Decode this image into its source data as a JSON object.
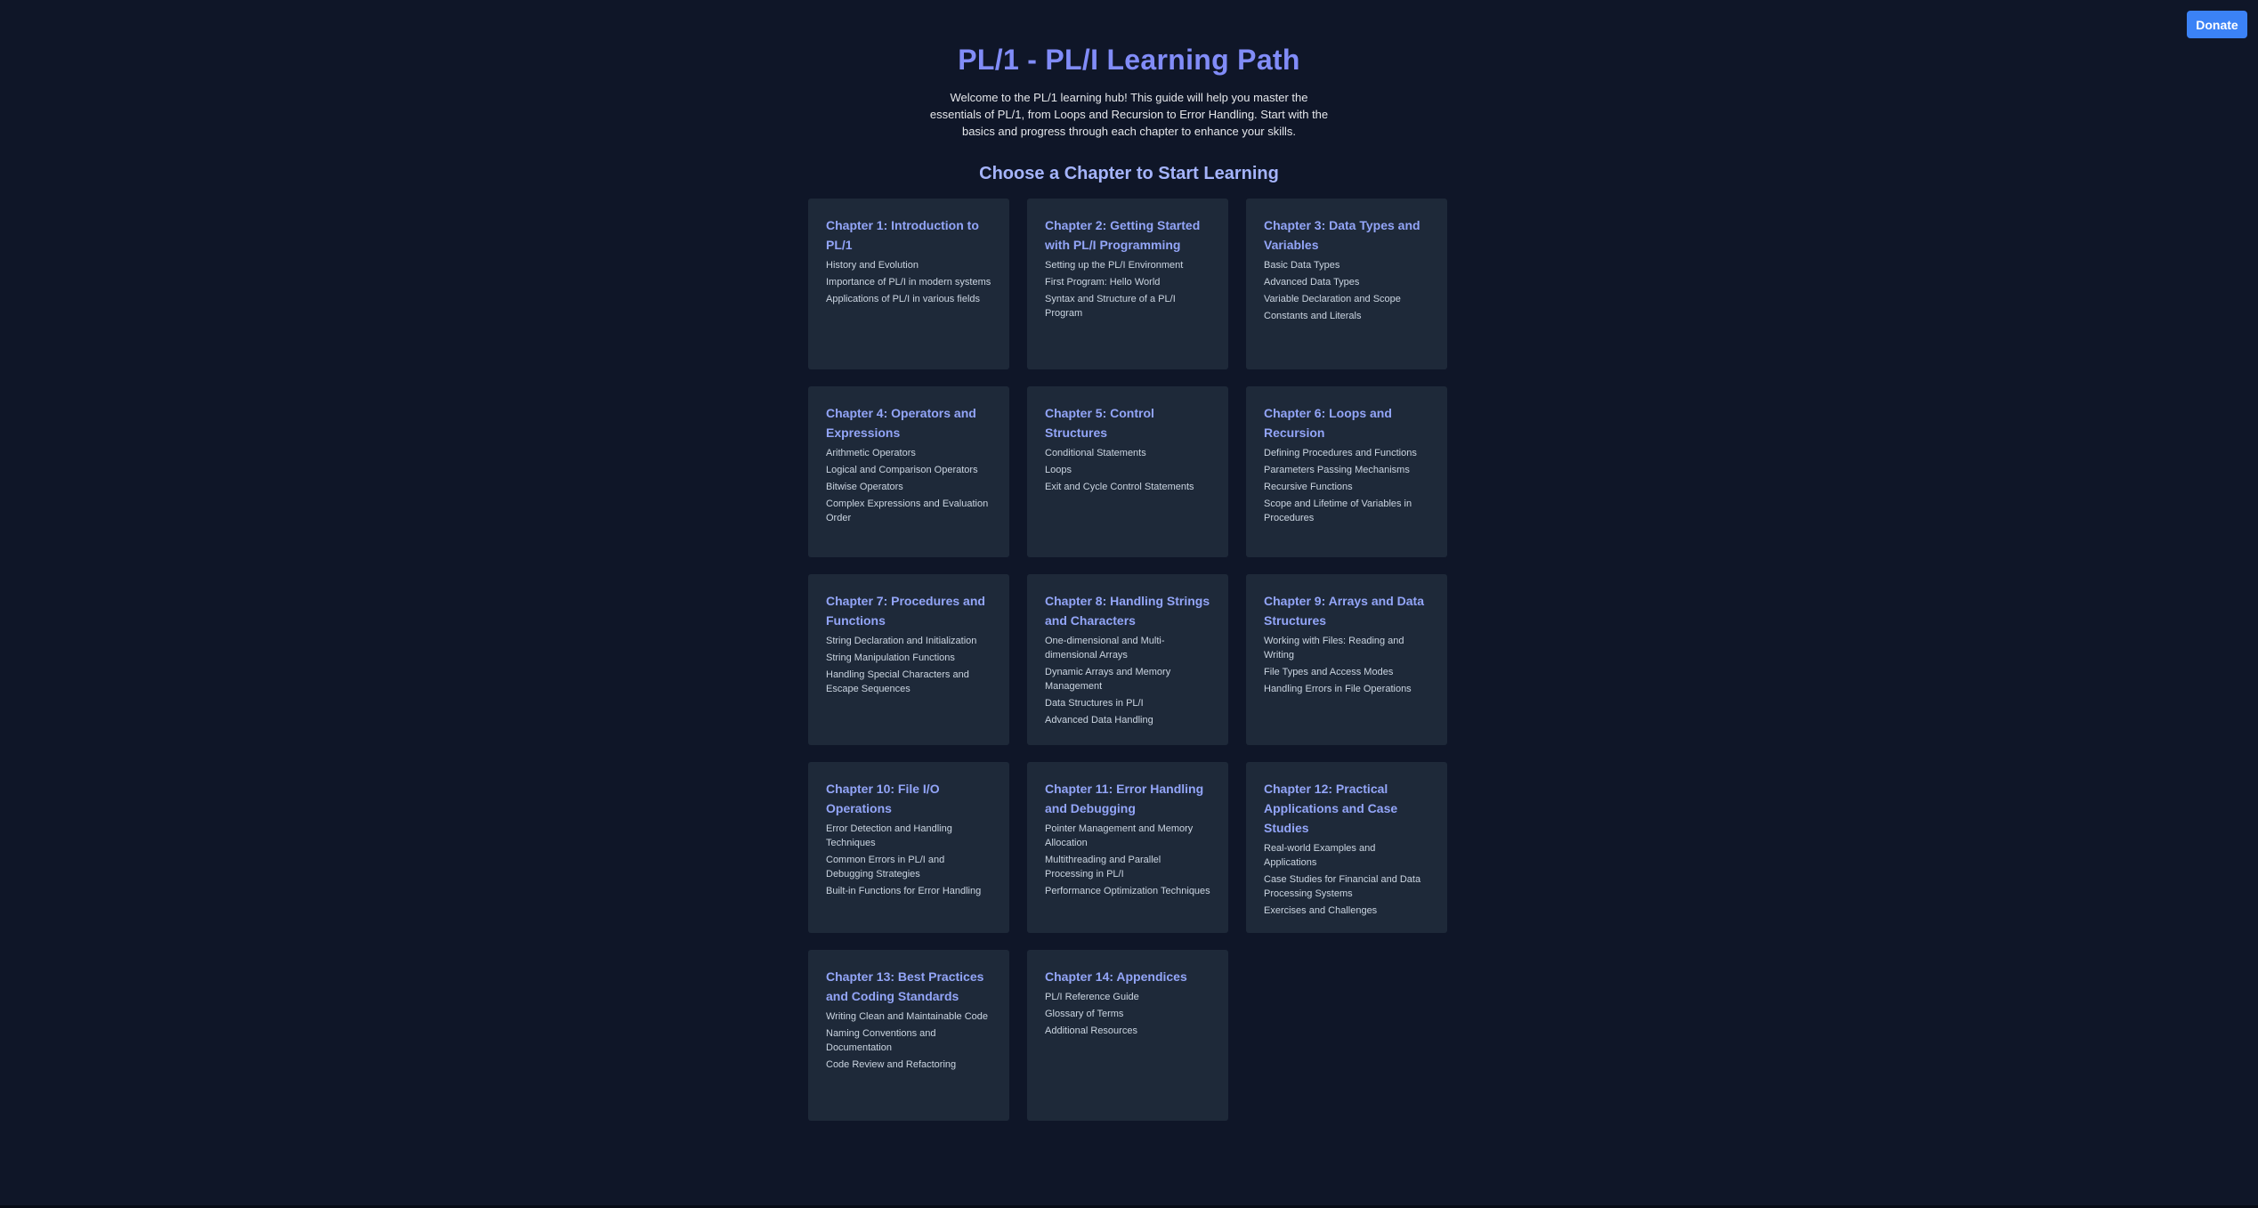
{
  "header": {
    "title": "PL/1 - PL/I Learning Path",
    "intro": "Welcome to the PL/1 learning hub! This guide will help you master the essentials of PL/1, from Loops and Recursion to Error Handling. Start with the basics and progress through each chapter to enhance your skills.",
    "section_title": "Choose a Chapter to Start Learning"
  },
  "donate_label": "Donate",
  "chapters": [
    {
      "title": "Chapter 1: Introduction to PL/1",
      "topics": [
        "History and Evolution",
        "Importance of PL/I in modern systems",
        "Applications of PL/I in various fields"
      ]
    },
    {
      "title": "Chapter 2: Getting Started with PL/I Programming",
      "topics": [
        "Setting up the PL/I Environment",
        "First Program: Hello World",
        "Syntax and Structure of a PL/I Program"
      ]
    },
    {
      "title": "Chapter 3: Data Types and Variables",
      "topics": [
        "Basic Data Types",
        "Advanced Data Types",
        "Variable Declaration and Scope",
        "Constants and Literals"
      ]
    },
    {
      "title": "Chapter 4: Operators and Expressions",
      "topics": [
        "Arithmetic Operators",
        "Logical and Comparison Operators",
        "Bitwise Operators",
        "Complex Expressions and Evaluation Order"
      ]
    },
    {
      "title": "Chapter 5: Control Structures",
      "topics": [
        "Conditional Statements",
        "Loops",
        "Exit and Cycle Control Statements"
      ]
    },
    {
      "title": "Chapter 6: Loops and Recursion",
      "topics": [
        "Defining Procedures and Functions",
        "Parameters Passing Mechanisms",
        "Recursive Functions",
        "Scope and Lifetime of Variables in Procedures"
      ]
    },
    {
      "title": "Chapter 7: Procedures and Functions",
      "topics": [
        "String Declaration and Initialization",
        "String Manipulation Functions",
        "Handling Special Characters and Escape Sequences"
      ]
    },
    {
      "title": "Chapter 8: Handling Strings and Characters",
      "topics": [
        "One-dimensional and Multi-dimensional Arrays",
        "Dynamic Arrays and Memory Management",
        "Data Structures in PL/I",
        "Advanced Data Handling"
      ]
    },
    {
      "title": "Chapter 9: Arrays and Data Structures",
      "topics": [
        "Working with Files: Reading and Writing",
        "File Types and Access Modes",
        "Handling Errors in File Operations"
      ]
    },
    {
      "title": "Chapter 10: File I/O Operations",
      "topics": [
        "Error Detection and Handling Techniques",
        "Common Errors in PL/I and Debugging Strategies",
        "Built-in Functions for Error Handling"
      ]
    },
    {
      "title": "Chapter 11: Error Handling and Debugging",
      "topics": [
        "Pointer Management and Memory Allocation",
        "Multithreading and Parallel Processing in PL/I",
        "Performance Optimization Techniques"
      ]
    },
    {
      "title": "Chapter 12: Practical Applications and Case Studies",
      "topics": [
        "Real-world Examples and Applications",
        "Case Studies for Financial and Data Processing Systems",
        "Exercises and Challenges"
      ]
    },
    {
      "title": "Chapter 13: Best Practices and Coding Standards",
      "topics": [
        "Writing Clean and Maintainable Code",
        "Naming Conventions and Documentation",
        "Code Review and Refactoring"
      ]
    },
    {
      "title": "Chapter 14: Appendices",
      "topics": [
        "PL/I Reference Guide",
        "Glossary of Terms",
        "Additional Resources"
      ]
    }
  ],
  "colors": {
    "background": "#0f1628",
    "card": "#1e2939",
    "title_accent": "#818cf8",
    "card_title": "#93a5f8",
    "donate_button": "#3b82f6"
  }
}
